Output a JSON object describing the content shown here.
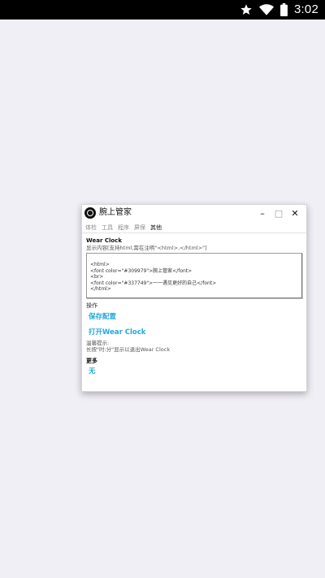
{
  "status_bar": {
    "time": "3:02",
    "icons": [
      "star-icon",
      "wifi-icon",
      "battery-icon"
    ]
  },
  "window": {
    "title": "腕上管家",
    "controls": {
      "minimize": "–",
      "maximize": "□",
      "close": "✕"
    },
    "tabs": [
      {
        "label": "体检",
        "active": false
      },
      {
        "label": "工具",
        "active": false
      },
      {
        "label": "程序",
        "active": false
      },
      {
        "label": "屏保",
        "active": false
      },
      {
        "label": "其他",
        "active": true
      }
    ]
  },
  "content": {
    "section_title": "Wear Clock",
    "display_hint": "显示内容[支持html,需在注明\"<html>,</html>\"]",
    "code_lines": [
      "<html>",
      "<font color=\"#309979\">腕上管家</font>",
      "<br>",
      "<font color=\"#337749\">一一遇见更好的自己</font>",
      "</html>"
    ],
    "ops_label": "操作",
    "save_label": "保存配置",
    "open_label": "打开Wear Clock",
    "tip_title": "温馨提示:",
    "tip_text": "长按\"时:分\"显示以退出Wear Clock",
    "more_title": "更多",
    "none_label": "无"
  },
  "colors": {
    "accent": "#21a8e0",
    "background": "#f0eff5",
    "status_bar": "#000000"
  }
}
